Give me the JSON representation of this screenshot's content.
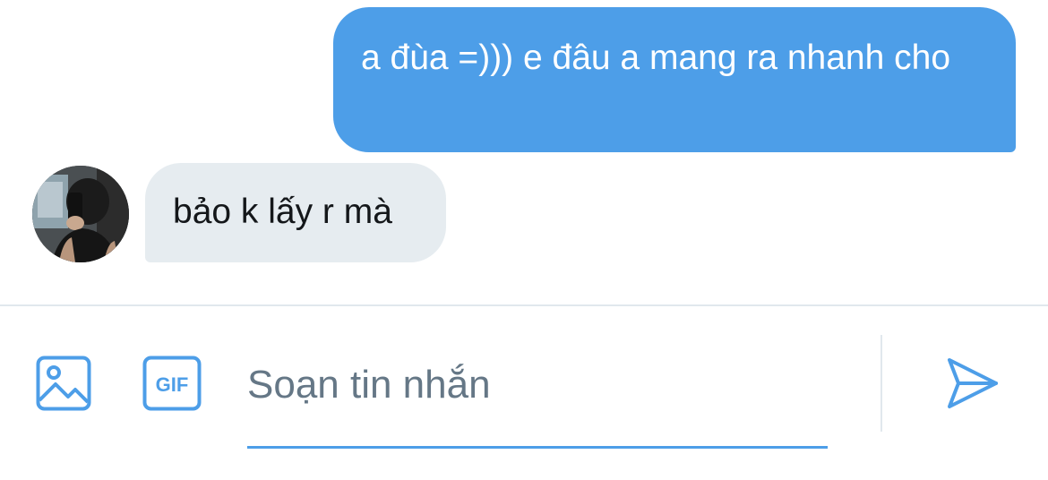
{
  "thread": {
    "sent_message": "a đùa =))) e đâu a mang ra nhanh cho",
    "received_message": "bảo k lấy r mà"
  },
  "composer": {
    "placeholder": "Soạn tin nhắn",
    "value": "",
    "gif_label": "GIF",
    "icons": [
      "image-icon",
      "gif-icon",
      "send-icon"
    ]
  },
  "colors": {
    "accent": "#4d9ee8",
    "received_bubble": "#e6ecf0",
    "placeholder_text": "#657786",
    "divider": "#e1e8ed"
  }
}
